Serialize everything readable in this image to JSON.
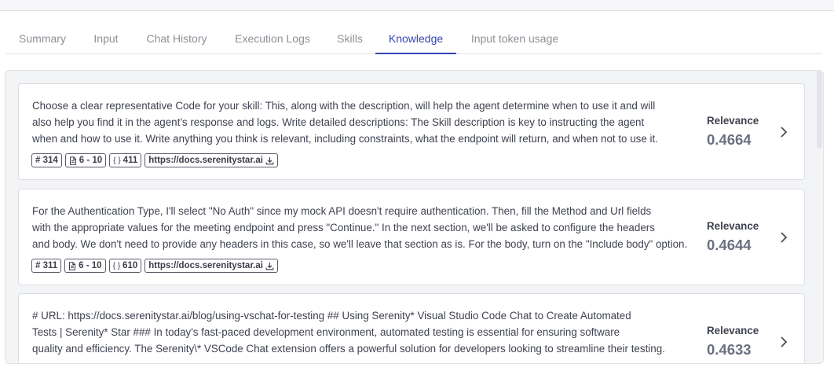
{
  "tabs": [
    {
      "label": "Summary"
    },
    {
      "label": "Input"
    },
    {
      "label": "Chat History"
    },
    {
      "label": "Execution Logs"
    },
    {
      "label": "Skills"
    },
    {
      "label": "Knowledge",
      "active": true
    },
    {
      "label": "Input token usage"
    }
  ],
  "results": [
    {
      "lines": [
        "Choose a clear representative Code for your skill: This, along with the description, will help the agent determine when to use it and will",
        "also help you find it in the agent's response and logs. Write detailed descriptions: The Skill description is key to instructing the agent",
        "when and how to use it. Write anything you think is relevant, including constraints, what the endpoint will return, and when not to use it."
      ],
      "id_tag": "# 314",
      "range_tag": "6 - 10",
      "tokens_tag": "411",
      "source": "https://docs.serenitystar.ai",
      "relevance_label": "Relevance",
      "relevance": "0.4664"
    },
    {
      "lines": [
        "For the Authentication Type, I'll select \"No Auth\" since my mock API doesn't require authentication. Then, fill the Method and Url fields",
        "with the appropriate values for the meeting endpoint and press \"Continue.\" In the next section, we'll be asked to configure the headers",
        "and body. We don't need to provide any headers in this case, so we'll leave that section as is. For the body, turn on the \"Include body\" option."
      ],
      "id_tag": "# 311",
      "range_tag": "6 - 10",
      "tokens_tag": "610",
      "source": "https://docs.serenitystar.ai",
      "relevance_label": "Relevance",
      "relevance": "0.4644"
    },
    {
      "lines": [
        "# URL: https://docs.serenitystar.ai/blog/using-vschat-for-testing ## Using Serenity* Visual Studio Code Chat to Create Automated",
        "Tests | Serenity* Star ### In today's fast-paced development environment, automated testing is essential for ensuring software",
        "quality and efficiency. The Serenity\\* VSCode Chat extension offers a powerful solution for developers looking to streamline their testing."
      ],
      "relevance_label": "Relevance",
      "relevance": "0.4633"
    }
  ],
  "colors": {
    "accent": "#3346b8",
    "panel_bg": "#f3f4f6",
    "card_border": "#dcdde2",
    "relevance_value": "#6b7080"
  },
  "icons": {
    "chevron": "chevron-right-icon",
    "range": "document-icon",
    "tokens": "braces-icon",
    "download": "download-icon"
  }
}
